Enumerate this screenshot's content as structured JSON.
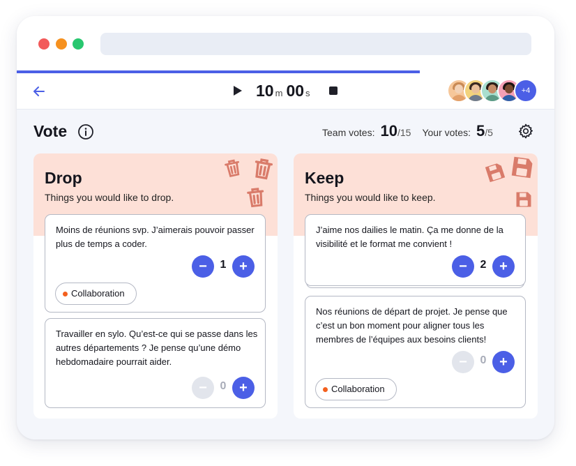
{
  "header": {
    "timer": {
      "minutes": "10",
      "minutes_unit": "m",
      "seconds": "00",
      "seconds_unit": "s"
    },
    "timer_progress": 0.75,
    "avatars": {
      "more_count": "+4"
    }
  },
  "vote": {
    "title": "Vote",
    "team_votes_label": "Team votes:",
    "team_votes": "10",
    "team_votes_total": "/15",
    "your_votes_label": "Your votes:",
    "your_votes": "5",
    "your_votes_total": "/5"
  },
  "columns": [
    {
      "title": "Drop",
      "subtitle": "Things you would like to drop.",
      "cards": [
        {
          "text": "Moins de réunions svp. J’aimerais pouvoir passer plus de temps a coder.",
          "votes": "1",
          "tag": "Collaboration"
        },
        {
          "text": "Travailler en sylo. Qu’est-ce qui se passe dans les autres départements ? Je pense qu’une démo hebdomadaire pourrait aider.",
          "votes": "0"
        }
      ]
    },
    {
      "title": "Keep",
      "subtitle": "Things you would like to keep.",
      "cards": [
        {
          "text": "J’aime nos dailies le matin. Ça me donne de la visibilité et le format me convient !",
          "votes": "2"
        },
        {
          "text": "Nos réunions de départ de projet. Je pense que c’est un bon moment pour aligner tous les membres de l’équipes aux besoins clients!",
          "votes": "0",
          "tag": "Collaboration"
        }
      ]
    }
  ],
  "colors": {
    "accent": "#4b5fe6",
    "column_header": "#fde0d7",
    "tag_dot": "#f3601e",
    "deco_icon": "#d97b6a"
  },
  "icons": [
    "arrow-left-icon",
    "play-icon",
    "stop-icon",
    "info-icon",
    "settings-icon",
    "trash-icon",
    "save-icon",
    "minus-icon",
    "plus-icon"
  ]
}
